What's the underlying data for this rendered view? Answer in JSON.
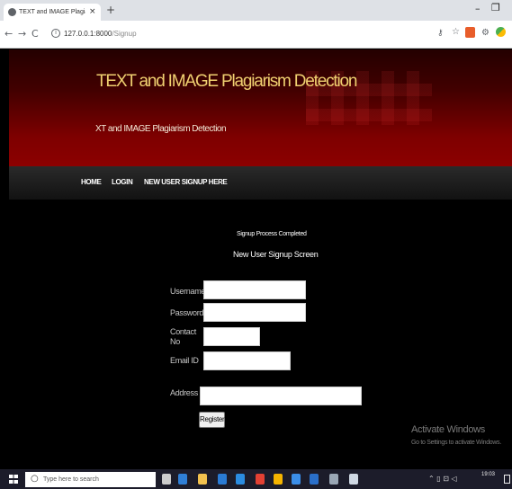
{
  "browser": {
    "tab_title": "TEXT and IMAGE Plagiarism Dete",
    "tab_close": "×",
    "new_tab": "+",
    "url_host": "127.0.0.1:8000",
    "url_path": "/Signup",
    "minimize": "–",
    "maximize": "❐"
  },
  "site": {
    "title": "TEXT and IMAGE Plagiarism Detection",
    "subtitle": "XT and IMAGE Plagiarism Detection"
  },
  "nav": {
    "items": [
      {
        "label": "HOME"
      },
      {
        "label": "LOGIN"
      },
      {
        "label": "NEW USER SIGNUP HERE"
      }
    ]
  },
  "signup": {
    "status": "Signup Process Completed",
    "heading": "New User Signup Screen",
    "fields": {
      "username": {
        "label": "Username",
        "value": ""
      },
      "password": {
        "label": "Password",
        "value": ""
      },
      "contact": {
        "label": "Contact No",
        "value": ""
      },
      "email": {
        "label": "Email ID",
        "value": ""
      },
      "address": {
        "label": "Address",
        "value": ""
      }
    },
    "register_label": "Register"
  },
  "watermark": {
    "title": "Activate Windows",
    "subtitle": "Go to Settings to activate Windows."
  },
  "taskbar": {
    "search_placeholder": "Type here to search",
    "clock_time": "19:03",
    "icons": [
      "task-view-icon",
      "edge-icon",
      "file-explorer-icon",
      "store-icon",
      "mail-icon",
      "chrome-icon",
      "python-icon",
      "vscode-icon",
      "notepad-icon",
      "document-icon",
      "files-icon"
    ]
  },
  "colors": {
    "banner_dark": "#240000",
    "banner_red": "#8c0000",
    "title_gold": "#f0d070",
    "nav_bg": "#1a1a1a"
  }
}
